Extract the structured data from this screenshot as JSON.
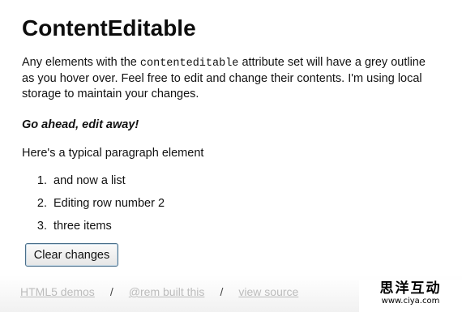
{
  "heading": "ContentEditable",
  "intro": {
    "before": "Any elements with the ",
    "code": "contenteditable",
    "after": " attribute set will have a grey outline as you hover over. Feel free to edit and change their contents. I'm using local storage to maintain your changes."
  },
  "emphasis": "Go ahead, edit away!",
  "paragraph": "Here's a typical paragraph element",
  "list": [
    "and now a list",
    "Editing row number 2",
    "three items"
  ],
  "button_label": "Clear changes",
  "footer": {
    "links": [
      "HTML5 demos",
      "@rem built this",
      "view source"
    ],
    "separator": "/"
  },
  "watermark": {
    "title": "思洋互动",
    "url": "www.ciya.com"
  }
}
